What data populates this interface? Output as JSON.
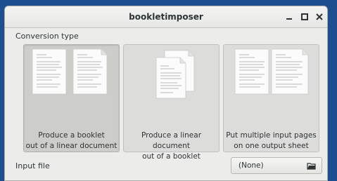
{
  "window": {
    "title": "bookletimposer"
  },
  "conversion": {
    "section_label": "Conversion type",
    "options": [
      {
        "line1": "Produce a booklet",
        "line2": "out of a linear document"
      },
      {
        "line1": "Produce a linear document",
        "line2": "out of a booklet"
      },
      {
        "line1": "Put multiple input pages",
        "line2": "on one output sheet"
      }
    ]
  },
  "input": {
    "label": "Input file",
    "file_value": "(None)"
  }
}
